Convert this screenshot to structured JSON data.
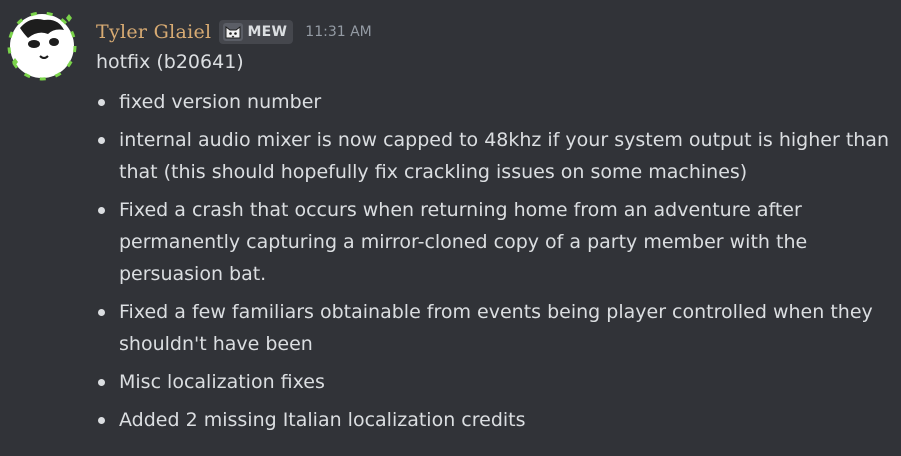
{
  "message": {
    "author": "Tyler Glaiel",
    "tag": {
      "icon": "cat-face-icon",
      "label": "MEW"
    },
    "timestamp": "11:31 AM",
    "title": "hotfix (b20641)",
    "notes": [
      "fixed version number",
      "internal audio mixer is now capped to 48khz if your system output is higher than that (this should hopefully fix crackling issues on some machines)",
      "Fixed a crash that occurs when returning home from an adventure after permanently capturing a mirror-cloned copy of a party member with the persuasion bat.",
      "Fixed a few familiars obtainable from events being player controlled when they shouldn't have been",
      "Misc localization fixes",
      "Added 2 missing Italian localization credits"
    ]
  },
  "colors": {
    "background": "#313338",
    "username": "#d8ab73",
    "text": "#dbdee1",
    "muted": "#949ba4",
    "tag_bg": "#45474d",
    "avatar_accent": "#7ad34a"
  }
}
